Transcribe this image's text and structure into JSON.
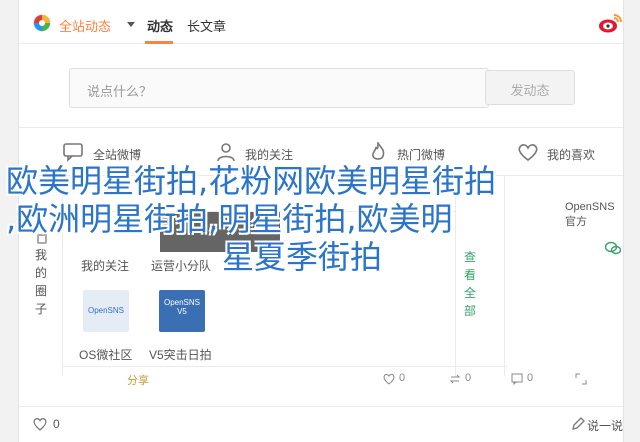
{
  "topbar": {
    "scope_label": "全站动态",
    "tab_feed": "动态",
    "tab_long": "长文章"
  },
  "composer": {
    "placeholder": "说点什么？",
    "input_text": "说点什么？",
    "send_label": "发动态"
  },
  "actions": [
    {
      "label": "全站微博",
      "icon": "chat-icon"
    },
    {
      "label": "我的关注",
      "icon": "person-icon"
    },
    {
      "label": "热门微博",
      "icon": "flame-icon"
    },
    {
      "label": "我的喜欢",
      "icon": "heart-icon"
    }
  ],
  "rail": {
    "label": "我的圈子"
  },
  "view_all": "查看全部",
  "feed_labels": {
    "my_follow": "我的关注",
    "op": "运营小分队",
    "sns_left": "OS微社区",
    "sns_right": "V5突击日拍",
    "opensns_official": "OpenSNS官方",
    "share": "分享",
    "tile_left": "OpenSNS",
    "tile_right": "OpenSNS V5"
  },
  "meta": {
    "count_1": "0",
    "count_2": "0",
    "count_3": "0"
  },
  "footer": {
    "like": "0",
    "comment": "说一说"
  },
  "headline": {
    "line1": "欧美明星街拍,花粉网欧美明星街拍",
    "line2": ",欧洲明星街拍,明星街拍,欧美明",
    "line3": "星夏季街拍"
  },
  "colors": {
    "accent": "#ff8140",
    "headline": "#2a74c9",
    "view_all": "#35a36b"
  }
}
